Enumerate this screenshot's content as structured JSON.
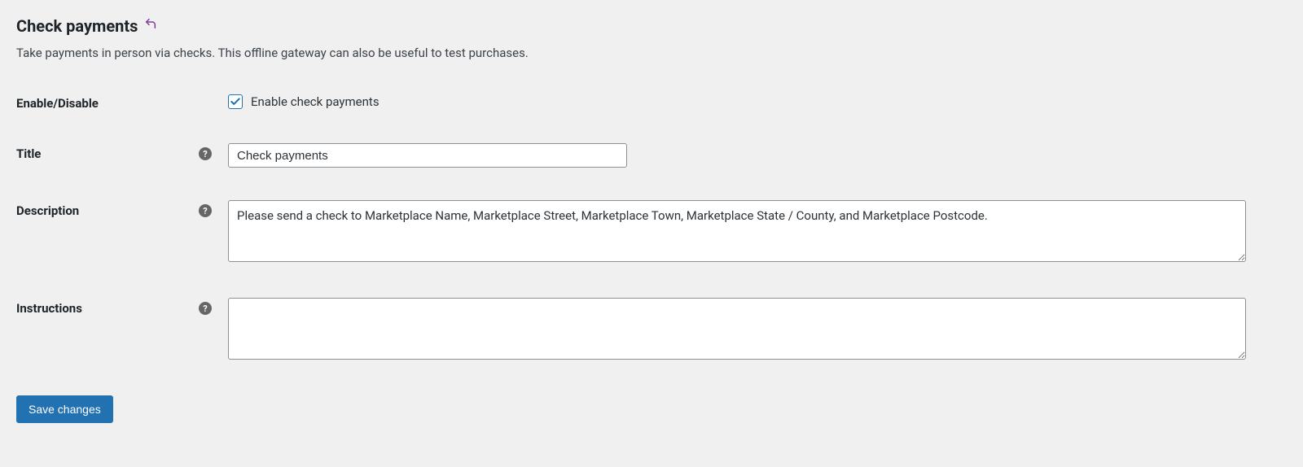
{
  "header": {
    "title": "Check payments"
  },
  "description": "Take payments in person via checks. This offline gateway can also be useful to test purchases.",
  "fields": {
    "enable": {
      "label": "Enable/Disable",
      "checkbox_label": "Enable check payments",
      "checked": true
    },
    "title": {
      "label": "Title",
      "value": "Check payments"
    },
    "description": {
      "label": "Description",
      "value": "Please send a check to Marketplace Name, Marketplace Street, Marketplace Town, Marketplace State / County, and Marketplace Postcode."
    },
    "instructions": {
      "label": "Instructions",
      "value": ""
    }
  },
  "actions": {
    "save": "Save changes"
  }
}
